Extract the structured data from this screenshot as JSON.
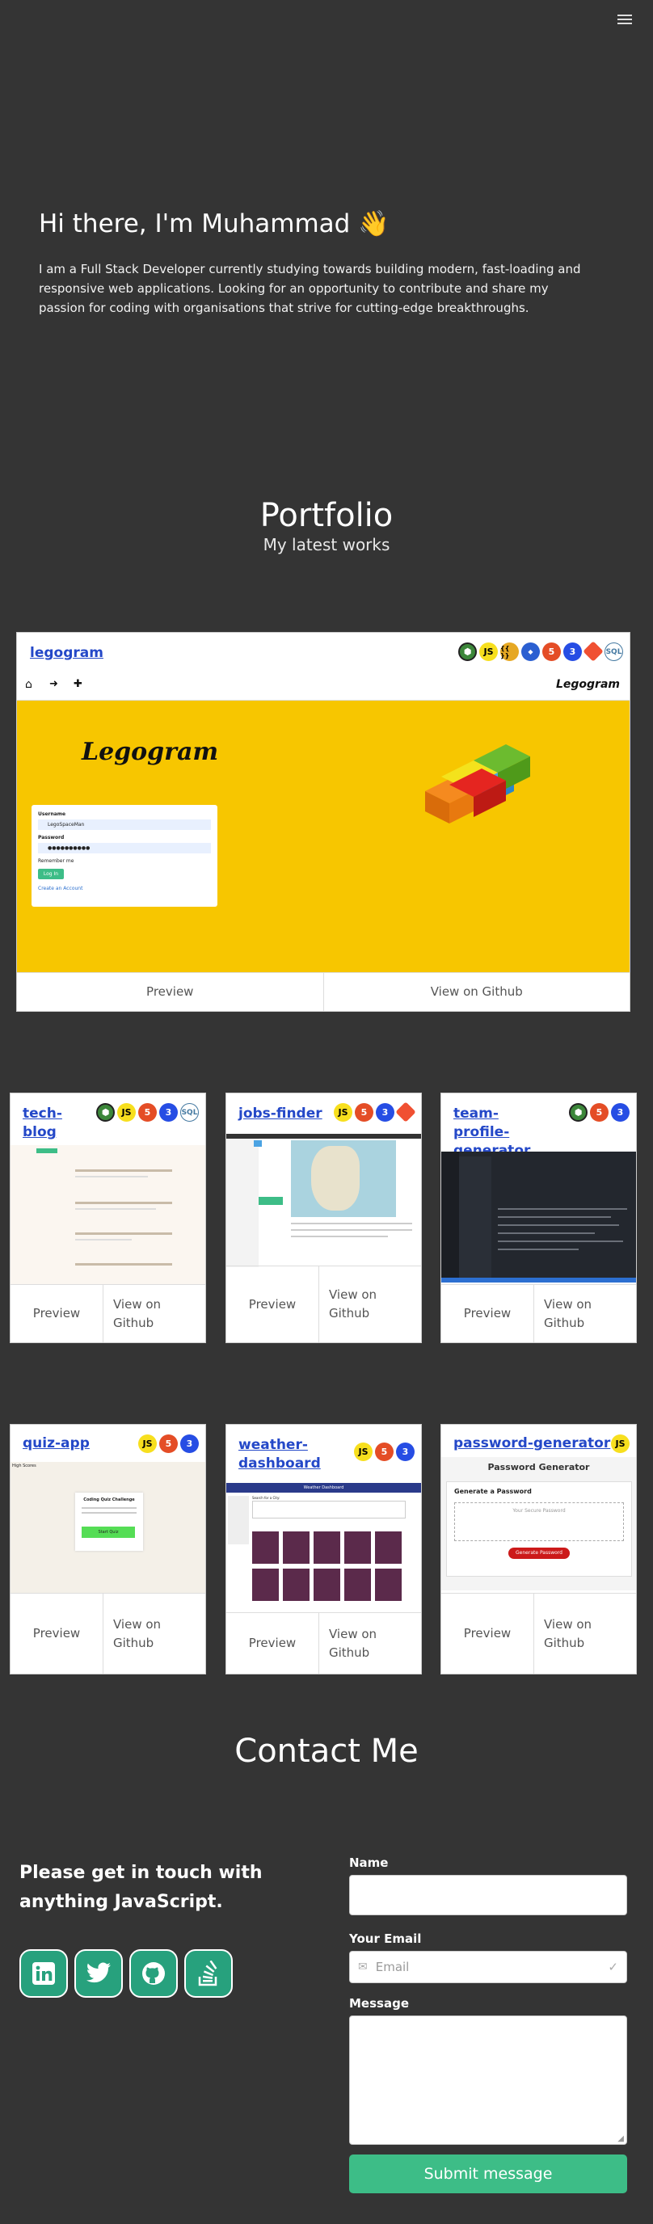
{
  "hero": {
    "heading": "Hi there, I'm Muhammad 👋",
    "intro": "I am a Full Stack Developer currently studying towards building modern, fast-loading and responsive web applications. Looking for an opportunity to contribute and share my passion for coding with organisations that strive for cutting-edge breakthroughs."
  },
  "portfolio": {
    "title": "Portfolio",
    "subtitle": "My latest works",
    "preview_label": "Preview",
    "github_label": "View on Github",
    "projects": [
      {
        "name": "legogram",
        "badges": [
          "node",
          "JS",
          "handlebars",
          "sequelize",
          "html",
          "css",
          "git",
          "mysql"
        ]
      },
      {
        "name": "tech-blog",
        "badges": [
          "node",
          "JS",
          "html",
          "css",
          "mysql"
        ]
      },
      {
        "name": "jobs-finder",
        "badges": [
          "JS",
          "html",
          "css",
          "git"
        ]
      },
      {
        "name": "team-profile-generator",
        "badges": [
          "node",
          "html",
          "css"
        ]
      },
      {
        "name": "quiz-app",
        "badges": [
          "JS",
          "html",
          "css"
        ]
      },
      {
        "name": "weather-dashboard",
        "badges": [
          "JS",
          "html",
          "css"
        ]
      },
      {
        "name": "password-generator",
        "badges": [
          "JS"
        ]
      }
    ],
    "legogram_shot": {
      "brand": "Legogram",
      "username_label": "Username",
      "username_value": "LegoSpaceMan",
      "password_label": "Password",
      "password_value": "●●●●●●●●●●",
      "remember": "Remember me",
      "login": "Log In",
      "create": "Create an Account"
    },
    "quiz_shot": {
      "header": "High Scores",
      "title": "Coding Quiz Challenge",
      "button": "Start Quiz"
    },
    "weather_shot": {
      "header": "Weather Dashboard",
      "label": "Search for a City:"
    },
    "password_shot": {
      "title": "Password Generator",
      "heading": "Generate a Password",
      "placeholder": "Your Secure Password",
      "button": "Generate Password"
    }
  },
  "contact": {
    "title": "Contact Me",
    "tagline": "Please get in touch with anything JavaScript.",
    "socials": [
      "linkedin-icon",
      "twitter-icon",
      "github-icon",
      "stackoverflow-icon"
    ],
    "name_label": "Name",
    "email_label": "Your Email",
    "email_placeholder": "Email",
    "message_label": "Message",
    "submit_label": "Submit message"
  }
}
